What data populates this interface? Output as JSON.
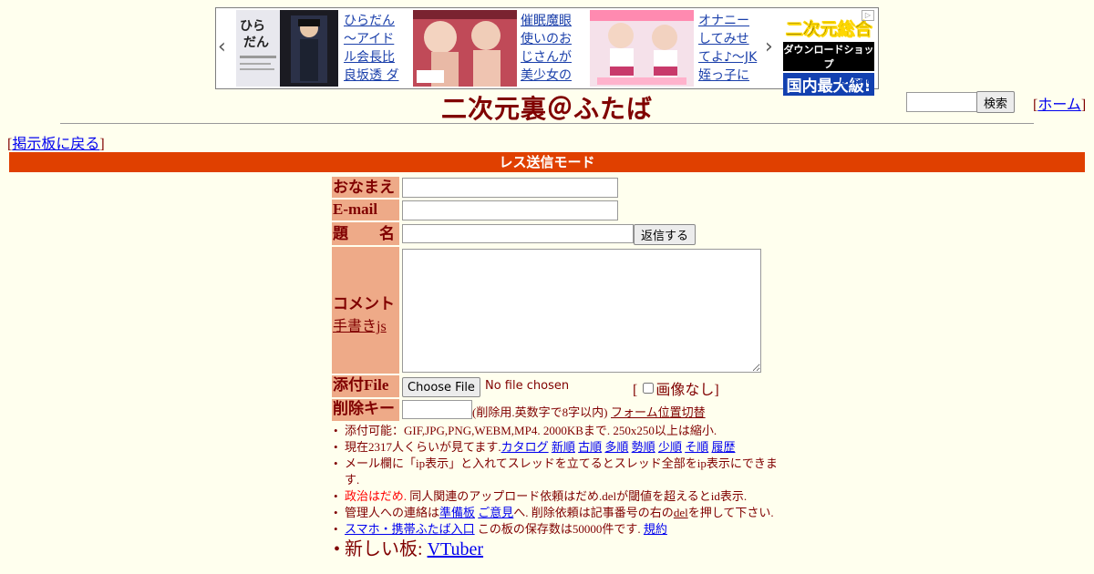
{
  "ad": {
    "items": [
      {
        "text": "ひらだん～アイドル会長比良坂透 ダ"
      },
      {
        "text": "催眠魔眼使いのおじさんが美少女の"
      },
      {
        "text": "オナニーしてみせてよ♪～JK姪っ子に"
      }
    ],
    "dlsite": {
      "line1": "二次元総合",
      "line2": "ダウンロードショップ",
      "line3": "国内最大級!",
      "brand": "DLsite"
    }
  },
  "header": {
    "title": "二次元裏＠ふたば",
    "search_button": "検索",
    "home_link": "ホーム",
    "back_link": "掲示板に戻る"
  },
  "mode_bar": "レス送信モード",
  "form": {
    "name_label": "おなまえ",
    "email_label": "E-mail",
    "subject_label": "題　　名",
    "submit_button": "返信する",
    "comment_label": "コメント",
    "handwrite_link": "手書きjs",
    "file_label": "添付File",
    "choose_file_button": "Choose File",
    "no_file_text": "No file chosen",
    "no_image_checkbox": "画像なし",
    "delete_key_label": "削除キー",
    "delete_key_note": "(削除用.英数字で8字以内)",
    "form_position_link": "フォーム位置切替"
  },
  "rules": {
    "r1": "添付可能：GIF,JPG,PNG,WEBM,MP4. 2000KBまで. 250x250以上は縮小.",
    "r2_prefix": "現在2317人くらいが見てます.",
    "r2_links": [
      "カタログ",
      "新順",
      "古順",
      "多順",
      "勢順",
      "少順",
      "そ順",
      "履歴"
    ],
    "r3": "メール欄に「ip表示」と入れてスレッドを立てるとスレッド全部をip表示にできます.",
    "r4_red": "政治はだめ.",
    "r4_rest": "同人関連のアップロード依頼はだめ.delが閾値を超えるとid表示.",
    "r5_a": "管理人への連絡は",
    "r5_link1": "準備板",
    "r5_link2": "ご意見",
    "r5_b": "へ. 削除依頼は記事番号の右の",
    "r5_del": "del",
    "r5_c": "を押して下さい.",
    "r6_link": "スマホ・携帯ふたば入口",
    "r6_text": "この板の保存数は50000件です.",
    "r6_rules": "規約",
    "r7_text": "新しい板:",
    "r7_link": "VTuber"
  },
  "colors": {
    "background": "#ffffee",
    "text": "#800000",
    "bar": "#e04000",
    "label_bg": "#eeaa88"
  }
}
